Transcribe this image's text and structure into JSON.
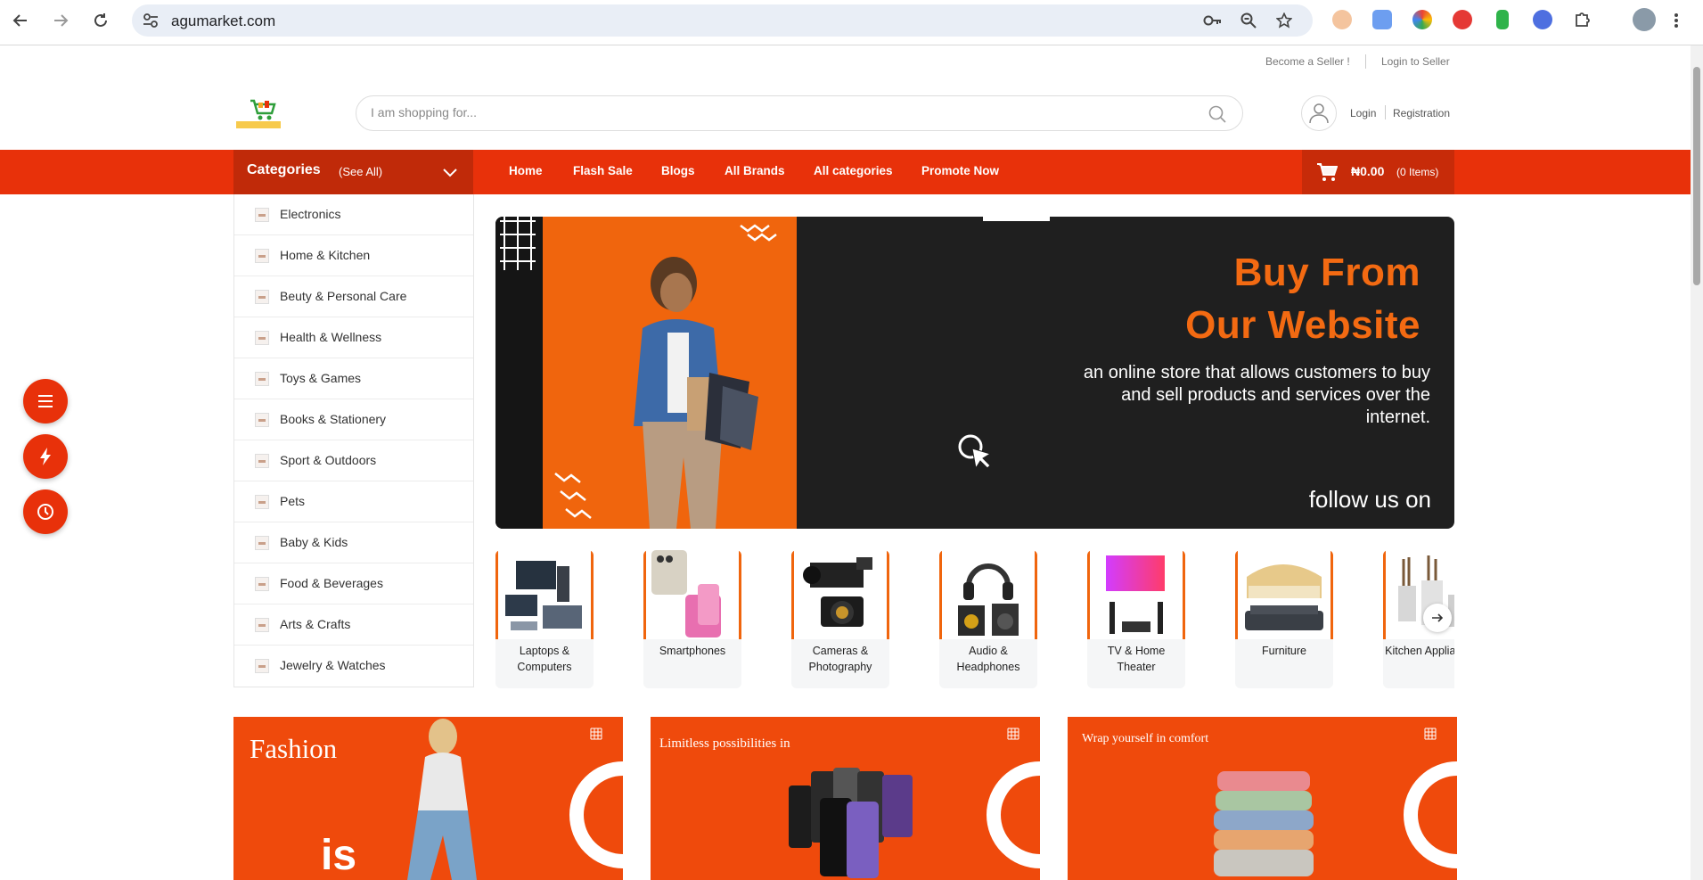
{
  "browser": {
    "url": "agumarket.com"
  },
  "topbar": {
    "become_seller": "Become a Seller !",
    "login_seller": "Login to Seller"
  },
  "header": {
    "search_placeholder": "I am shopping for...",
    "login": "Login",
    "registration": "Registration"
  },
  "nav": {
    "categories_title": "Categories",
    "see_all": "(See All)",
    "links": [
      "Home",
      "Flash Sale",
      "Blogs",
      "All Brands",
      "All categories",
      "Promote Now"
    ],
    "cart_amount": "₦0.00",
    "cart_items": "(0 Items)"
  },
  "sidebar": {
    "items": [
      "Electronics",
      "Home & Kitchen",
      "Beuty & Personal Care",
      "Health & Wellness",
      "Toys & Games",
      "Books & Stationery",
      "Sport & Outdoors",
      "Pets",
      "Baby & Kids",
      "Food & Beverages",
      "Arts & Crafts",
      "Jewelry & Watches"
    ]
  },
  "hero": {
    "title_line1": "Buy From",
    "title_line2": "Our Website",
    "description": "an online store that allows customers to buy and sell products and services over the internet.",
    "follow": "follow us on"
  },
  "carousel": {
    "cards": [
      {
        "label": "Laptops & Computers"
      },
      {
        "label": "Smartphones"
      },
      {
        "label": "Cameras & Photography"
      },
      {
        "label": "Audio & Headphones"
      },
      {
        "label": "TV & Home Theater"
      },
      {
        "label": "Furniture"
      },
      {
        "label": "Kitchen Appliances"
      }
    ]
  },
  "promos": {
    "items": [
      {
        "title": "Fashion",
        "subtitle": "is"
      },
      {
        "title": "Limitless possibilities in"
      },
      {
        "title": "Wrap yourself in comfort"
      }
    ]
  },
  "colors": {
    "brand_red": "#e8310a",
    "brand_orange": "#f0650d"
  }
}
